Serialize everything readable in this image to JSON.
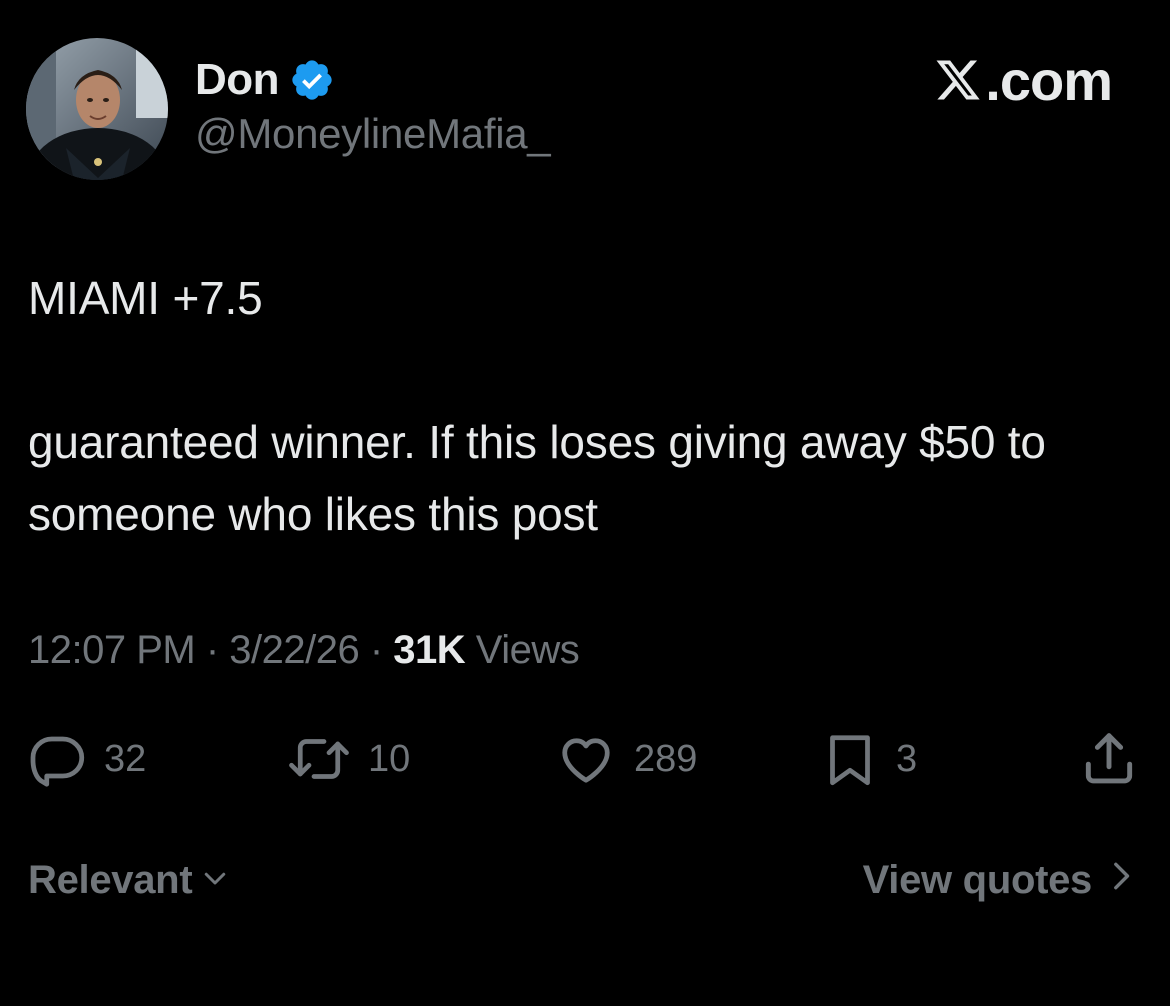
{
  "author": {
    "display_name": "Don",
    "handle": "@MoneylineMafia_",
    "verified": true,
    "avatar_icon": "profile-photo"
  },
  "brand": {
    "text": ".com",
    "logo_icon": "x-logo-icon"
  },
  "tweet": {
    "line1": "MIAMI +7.5",
    "line2": "guaranteed winner. If this loses giving away $50 to someone who likes this post"
  },
  "meta": {
    "time": "12:07 PM",
    "separator": " · ",
    "date": "3/22/26",
    "views_count": "31K",
    "views_label": "Views"
  },
  "actions": {
    "replies": "32",
    "reposts": "10",
    "likes": "289",
    "bookmarks": "3"
  },
  "footer": {
    "sort_label": "Relevant",
    "view_quotes_label": "View quotes"
  },
  "colors": {
    "background": "#000000",
    "text_primary": "#e7e9ea",
    "text_secondary": "#71767b",
    "verified_blue": "#1d9bf0"
  }
}
